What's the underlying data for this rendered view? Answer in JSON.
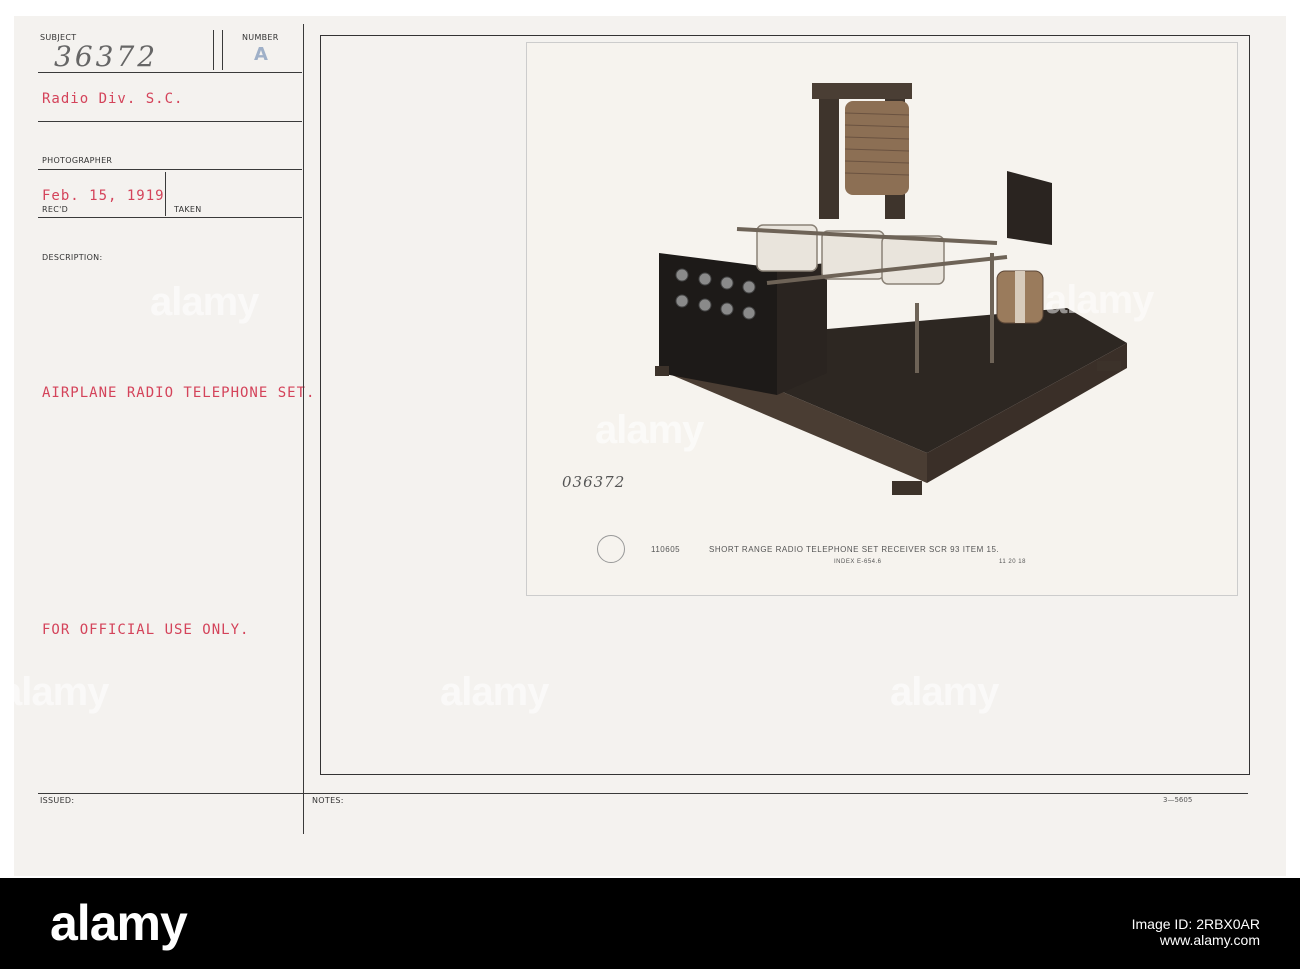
{
  "card": {
    "subject_label": "SUBJECT",
    "number_label": "NUMBER",
    "handwritten_number": "36372",
    "stamp_letter": "A",
    "division": "Radio Div. S.C.",
    "photographer_label": "PHOTOGRAPHER",
    "date": "Feb. 15, 1919",
    "recd_label": "REC'D",
    "taken_label": "TAKEN",
    "description_label": "DESCRIPTION:",
    "description": "AIRPLANE RADIO TELEPHONE SET.",
    "official_use": "FOR OFFICIAL USE ONLY.",
    "issued_label": "ISSUED:",
    "notes_label": "NOTES:",
    "form_code": "3—5605"
  },
  "photo": {
    "handwritten_ref": "036372",
    "negative_number": "110605",
    "caption": "SHORT RANGE RADIO TELEPHONE SET RECEIVER SCR 93 ITEM 15.",
    "index": "INDEX E-654.6",
    "date_code": "11 20 18"
  },
  "watermark_text": "alamy",
  "footer": {
    "brand": "alamy",
    "image_id": "Image ID: 2RBX0AR",
    "site": "www.alamy.com"
  },
  "colors": {
    "typewriter_red": "#d4435a",
    "card_bg": "#f4f2ef",
    "footer_bg": "#000000"
  }
}
